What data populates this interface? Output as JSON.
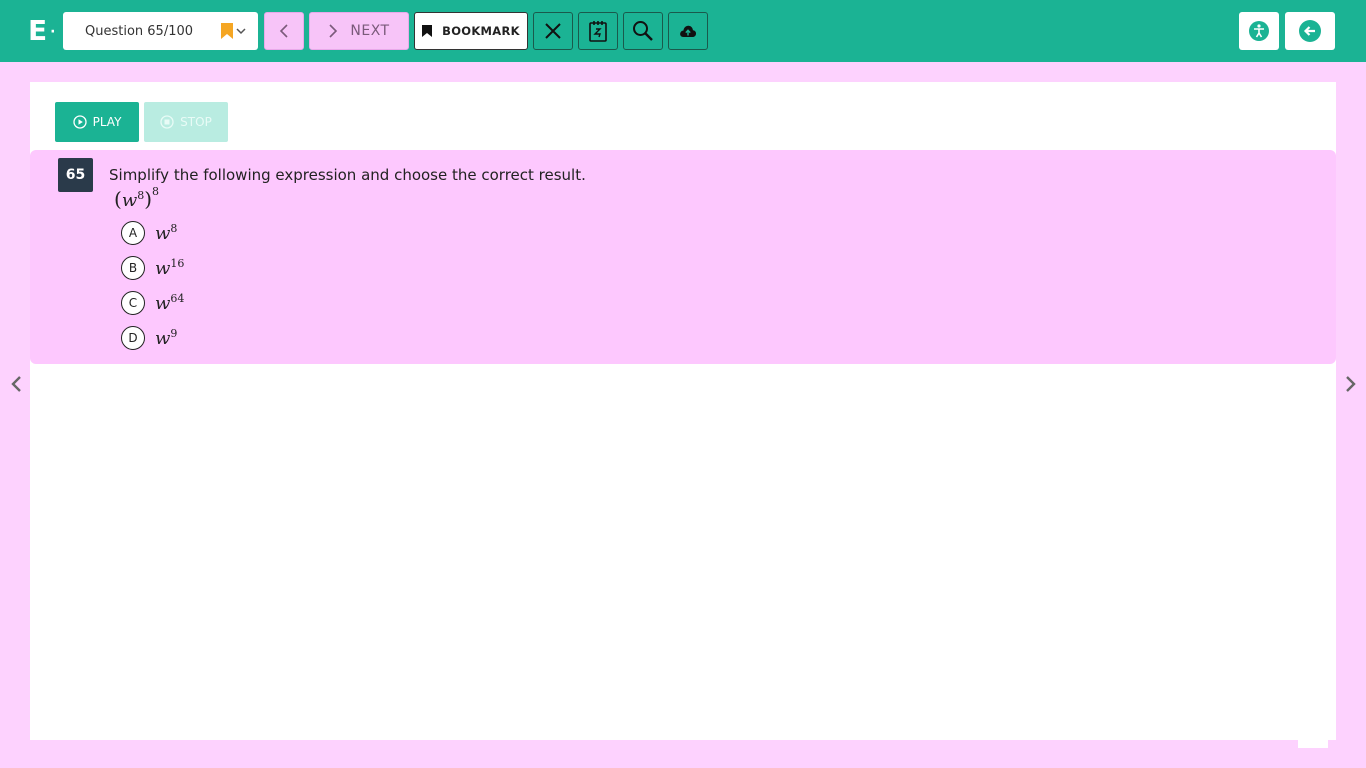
{
  "header": {
    "logo_text": "E",
    "logo_dot": "·",
    "question_selector": "Question 65/100",
    "next_label": "NEXT",
    "bookmark_label": "BOOKMARK"
  },
  "media": {
    "play_label": "PLAY",
    "stop_label": "STOP"
  },
  "question": {
    "number": "65",
    "prompt": "Simplify the following expression and choose the correct result.",
    "expression": {
      "base": "w",
      "inner_exp": "8",
      "outer_exp": "8"
    },
    "choices": [
      {
        "letter": "A",
        "base": "w",
        "exp": "8"
      },
      {
        "letter": "B",
        "base": "w",
        "exp": "16"
      },
      {
        "letter": "C",
        "base": "w",
        "exp": "64"
      },
      {
        "letter": "D",
        "base": "w",
        "exp": "9"
      }
    ]
  },
  "colors": {
    "brand": "#1bb394",
    "background": "#fdd2fe",
    "question_panel": "#fdc8fe",
    "bookmark_flag": "#f5a623"
  },
  "icons": {
    "toolbar": [
      "close-icon",
      "notepad-icon",
      "search-icon",
      "cloud-upload-icon"
    ],
    "right": [
      "accessibility-icon",
      "exit-icon"
    ]
  }
}
